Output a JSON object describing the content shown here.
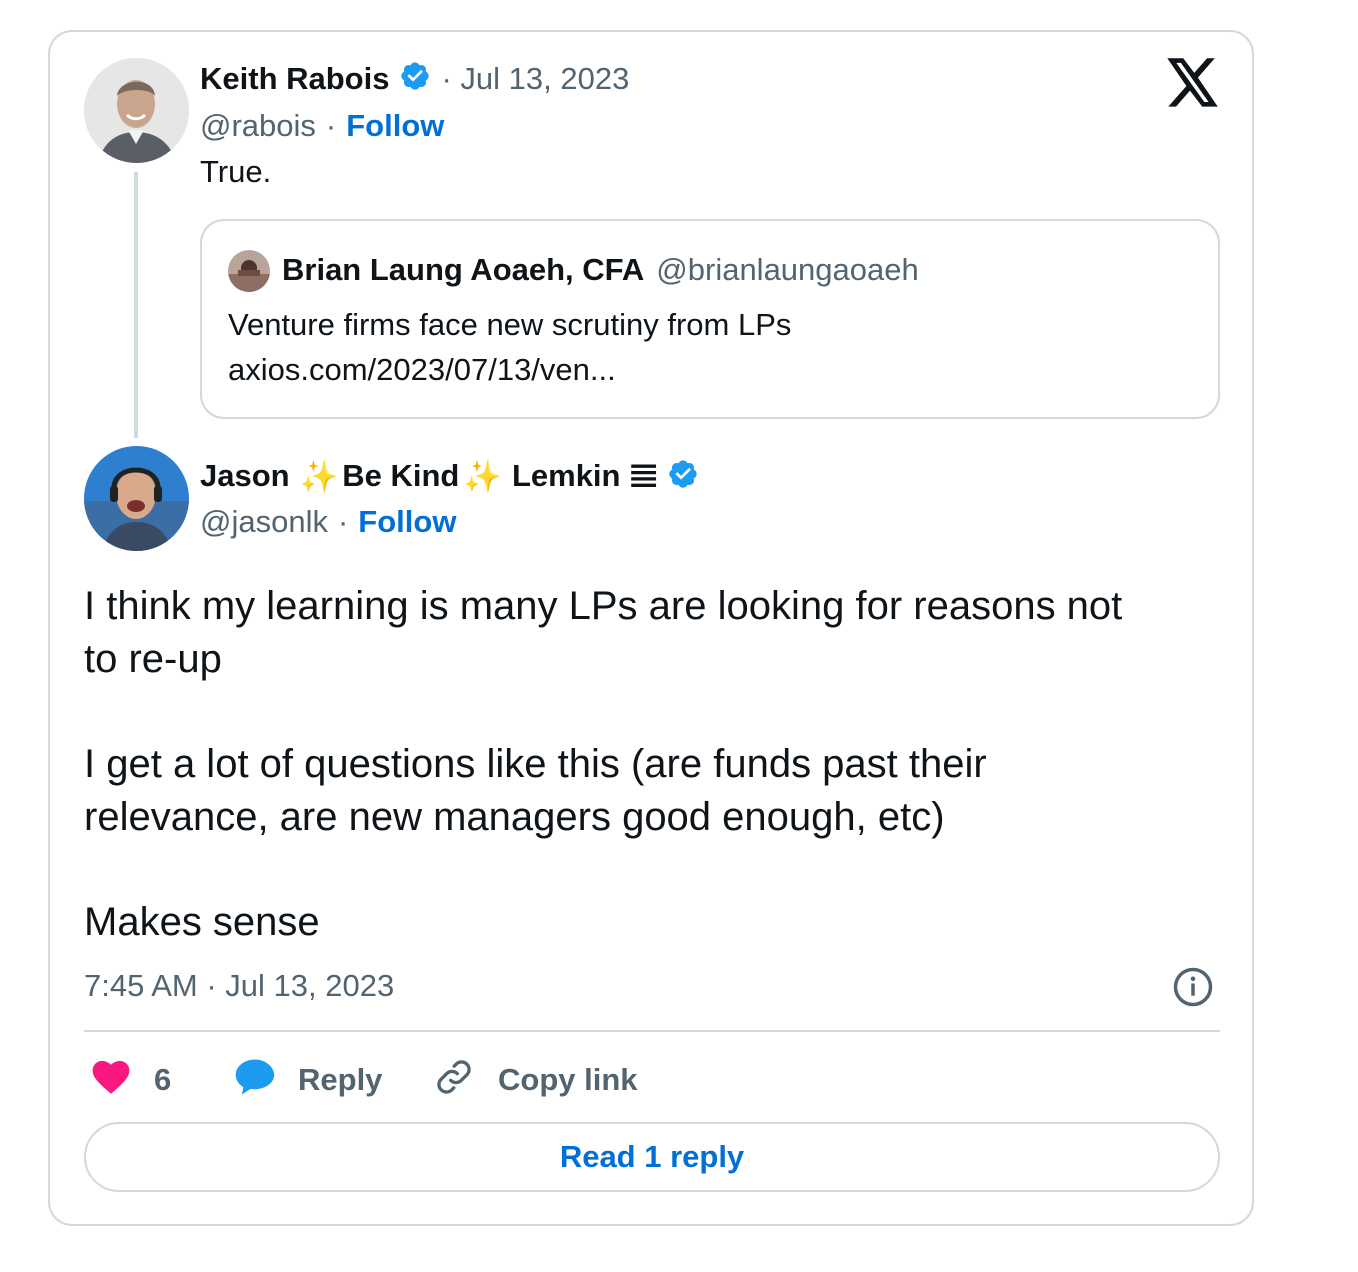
{
  "first_tweet": {
    "author_name": "Keith Rabois",
    "date": "· Jul 13, 2023",
    "handle": "@rabois",
    "separator": "·",
    "follow_label": "Follow",
    "text": "True."
  },
  "quoted_tweet": {
    "author_name": "Brian Laung Aoaeh, CFA",
    "handle": "@brianlaungaoaeh",
    "text": "Venture firms face new scrutiny from LPs",
    "link": "axios.com/2023/07/13/ven..."
  },
  "main_tweet": {
    "name_part1": "Jason",
    "sparkle_1": "✨",
    "name_part2": "Be Kind",
    "sparkle_2": "✨",
    "name_part3": "Lemkin",
    "name_glyph": "𝌆",
    "handle": "@jasonlk",
    "separator": "·",
    "follow_label": "Follow",
    "paragraphs": [
      {
        "lines": [
          "I think my learning is many LPs are looking for reasons not",
          "to re-up"
        ]
      },
      {
        "lines": [
          "I get a lot of questions like this (are funds past their",
          "relevance, are new managers good enough, etc)"
        ]
      },
      {
        "lines": [
          "Makes sense"
        ]
      }
    ],
    "timestamp": "7:45 AM · Jul 13, 2023"
  },
  "actions": {
    "like_count": "6",
    "reply_label": "Reply",
    "copy_link_label": "Copy link"
  },
  "read_replies_label": "Read 1 reply",
  "colors": {
    "accent": "#1d9bf0",
    "link": "#006fd6",
    "like": "#f91880",
    "border": "#cfd9de",
    "muted": "#536471"
  },
  "icons": [
    "x-logo-icon",
    "verified-badge-icon",
    "heart-icon",
    "reply-bubble-icon",
    "link-icon",
    "info-icon"
  ]
}
